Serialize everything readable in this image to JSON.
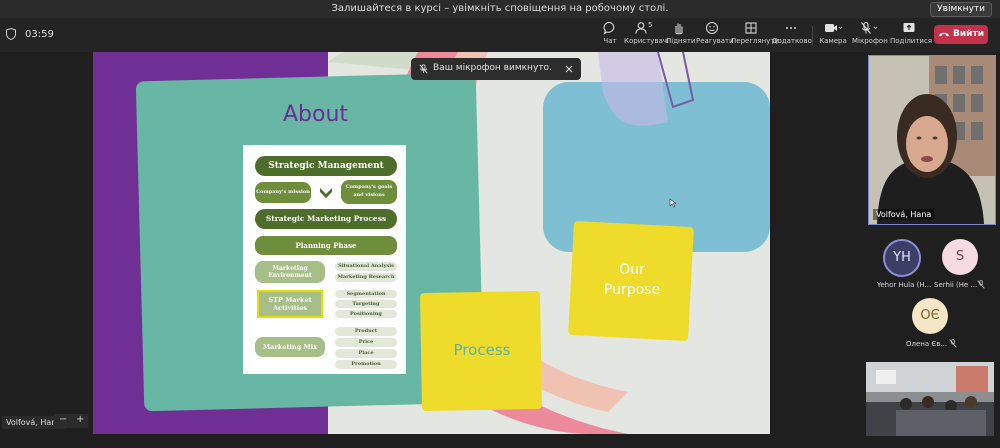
{
  "banner": {
    "text": "Залишайтеся в курсі – увімкніть сповіщення на робочому столі.",
    "button": "Увімкнути"
  },
  "toolbar": {
    "time": "03:59",
    "items": [
      {
        "label": "Чат",
        "icon": "chat-icon"
      },
      {
        "label": "Користувачі",
        "icon": "people-icon",
        "count": "5"
      },
      {
        "label": "Підняти",
        "icon": "raise-hand-icon"
      },
      {
        "label": "Реагувати",
        "icon": "smile-icon"
      },
      {
        "label": "Переглянути",
        "icon": "view-grid-icon"
      },
      {
        "label": "Додатково",
        "icon": "more-icon"
      },
      {
        "label": "Камера",
        "icon": "camera-icon"
      },
      {
        "label": "Мікрофон",
        "icon": "mic-icon"
      },
      {
        "label": "Поділитися",
        "icon": "share-icon"
      }
    ],
    "leave": "Вийти"
  },
  "toast": {
    "text": "Ваш мікрофон вимкнуто."
  },
  "slide": {
    "title": "About",
    "process": "Process",
    "purpose_line1": "Our",
    "purpose_line2": "Purpose",
    "diagram": {
      "strategic_management": "Strategic Management",
      "company_mission": "Company's mission",
      "company_goals": "Company's goals and visions",
      "smp": "Strategic Marketing Process",
      "planning": "Planning Phase",
      "marketing_env": "Marketing Environment",
      "situational": "Situational Analysis",
      "research": "Marketing Research",
      "stp": "STP Market Activities",
      "segmentation": "Segmentation",
      "targeting": "Targeting",
      "positioning": "Positioning",
      "marketing_mix": "Marketing Mix",
      "product": "Product",
      "price": "Price",
      "place": "Place",
      "promotion": "Promotion"
    }
  },
  "speaker": {
    "name": "Volfová, Hana"
  },
  "participants": [
    {
      "initials": "YH",
      "name": "Yehor Hula (H...",
      "bg": "#3b3f66",
      "fg": "#e7e0ff"
    },
    {
      "initials": "S",
      "name": "Serhii (Не ...",
      "bg": "#f6dbe0",
      "fg": "#8a3a4a"
    },
    {
      "initials": "OЄ",
      "name": "Олена Єв...",
      "bg": "#f6e6c8",
      "fg": "#7a5a20"
    }
  ],
  "self_view": {
    "name": "Volfová, Hana"
  },
  "zoom": {
    "minus": "−",
    "plus": "+"
  },
  "colors": {
    "accent_purple": "#6f2f94",
    "teal": "#67b7a4",
    "yellow": "#efdc2a",
    "leave_red": "#c4314b"
  }
}
